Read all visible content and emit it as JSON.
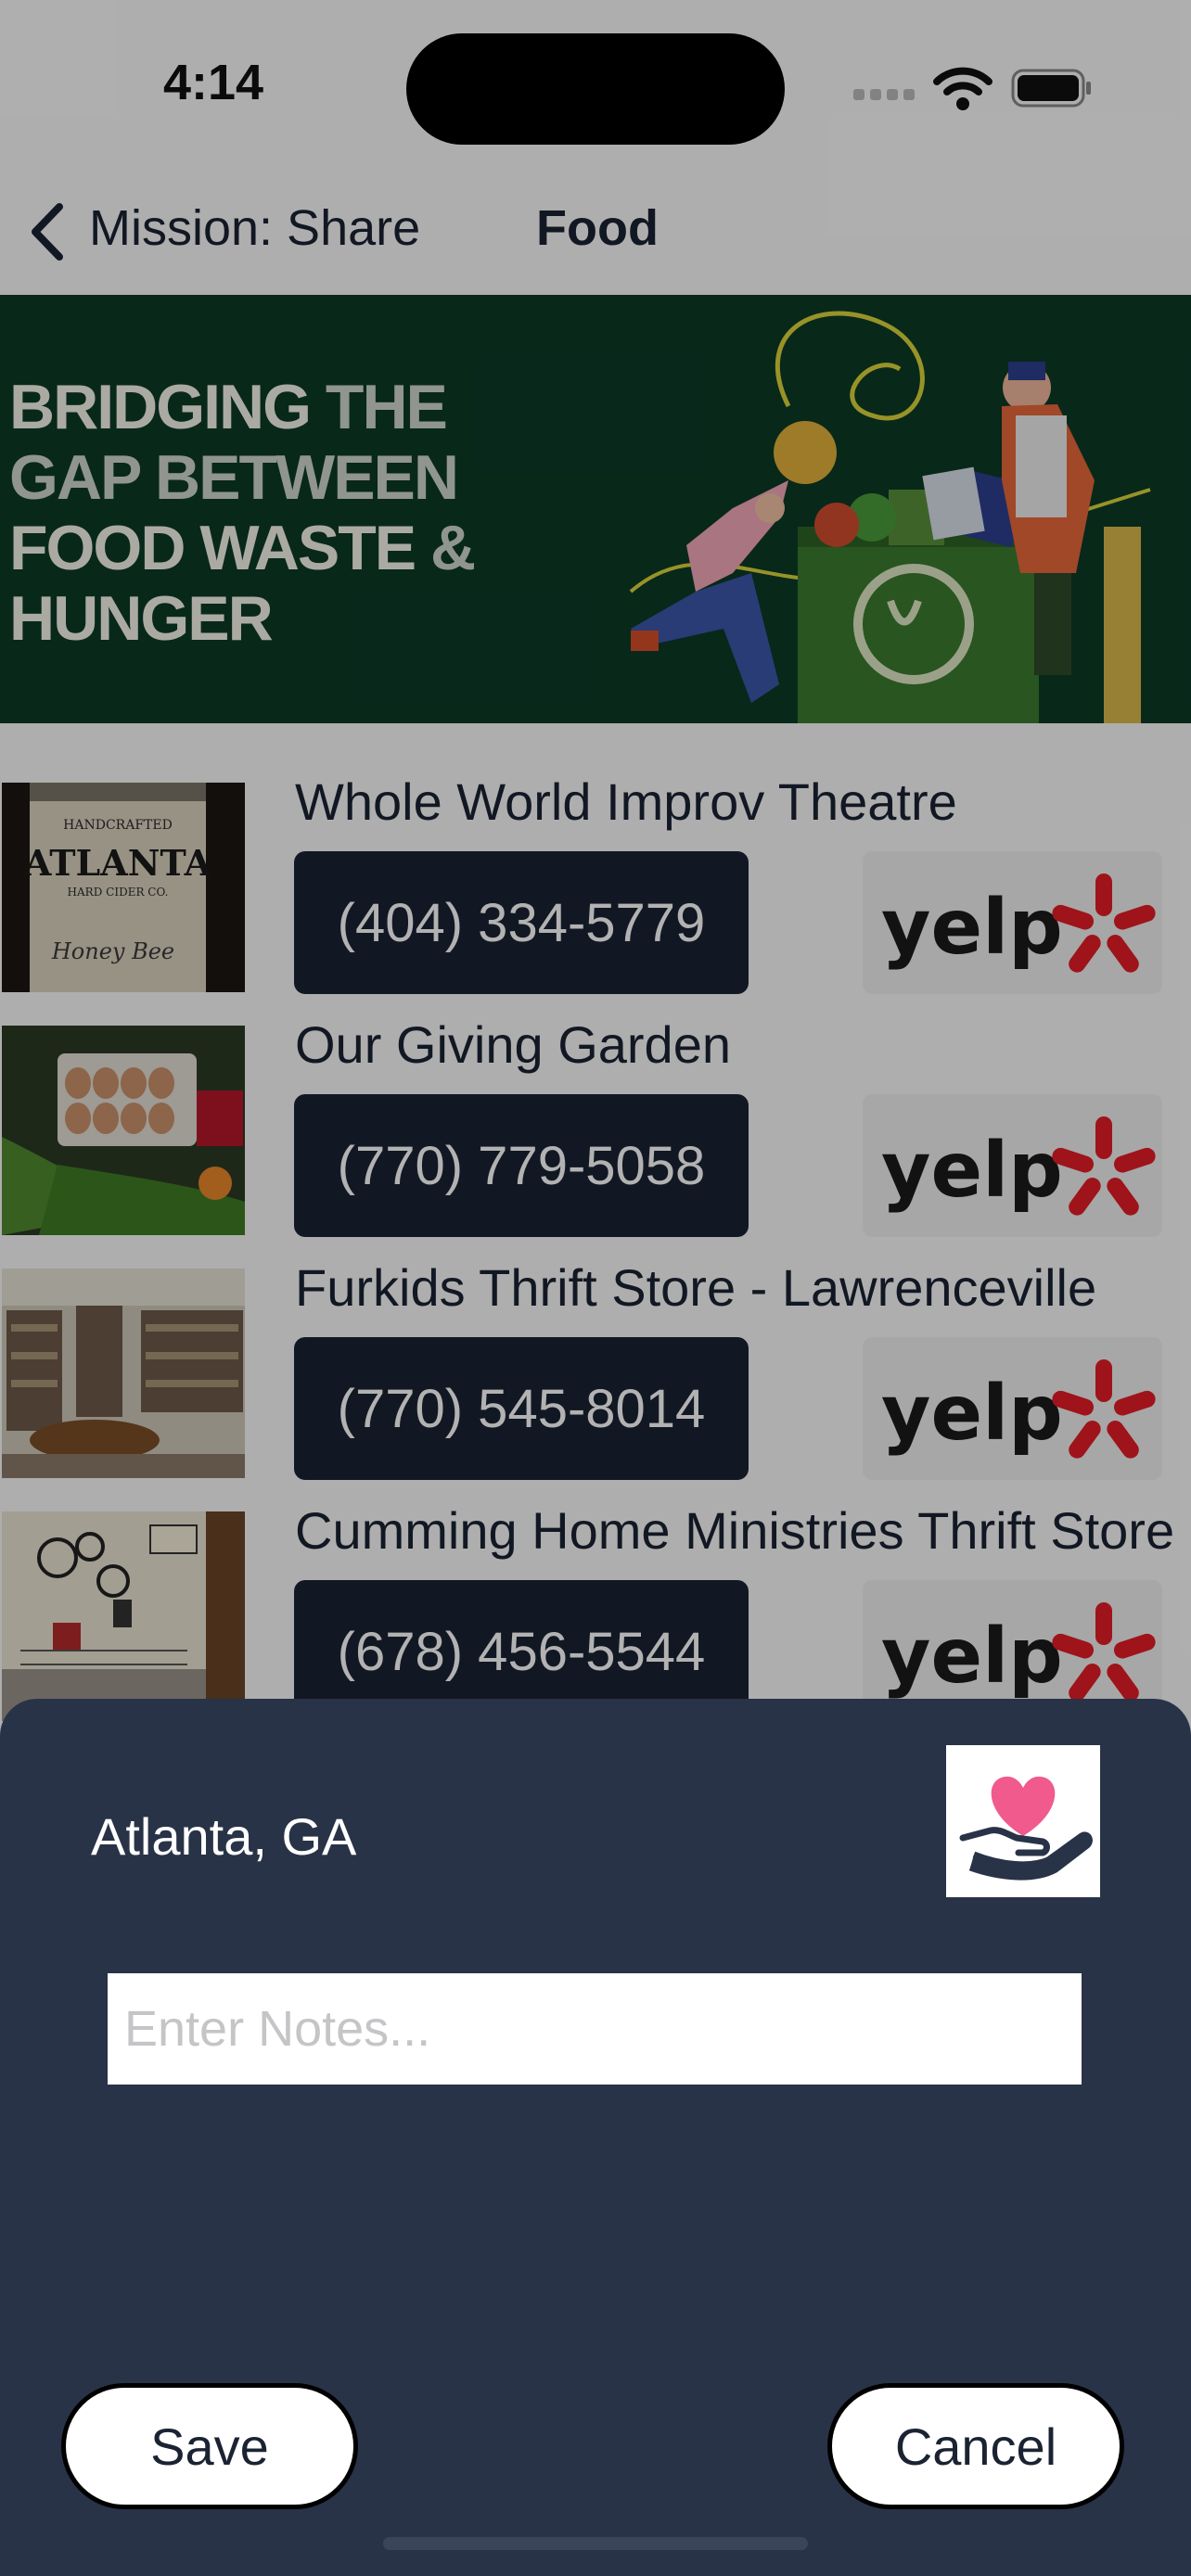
{
  "status_bar": {
    "time": "4:14"
  },
  "nav": {
    "back_label": "Mission: Share",
    "title": "Food"
  },
  "banner": {
    "line1_a": "BRIDGING ",
    "line1_b": "THE",
    "line2": "GAP BETWEEN",
    "line3_a": "FOOD WASTE ",
    "line3_b": "&",
    "line4": "HUNGER"
  },
  "listings": [
    {
      "name": "Whole World Improv Theatre",
      "phone": "(404) 334-5779",
      "yelp": "yelp"
    },
    {
      "name": "Our Giving Garden",
      "phone": "(770) 779-5058",
      "yelp": "yelp"
    },
    {
      "name": "Furkids Thrift Store - Lawrenceville",
      "phone": "(770) 545-8014",
      "yelp": "yelp"
    },
    {
      "name": "Cumming Home Ministries Thrift Store",
      "phone": "(678) 456-5544",
      "yelp": "yelp"
    }
  ],
  "thumb_text": {
    "brand": "ATLANTA",
    "top": "HANDCRAFTED",
    "sub": "HARD CIDER CO.",
    "script": "Honey Bee"
  },
  "sheet": {
    "location": "Atlanta, GA",
    "notes_placeholder": "Enter Notes...",
    "notes_value": "",
    "save_label": "Save",
    "cancel_label": "Cancel"
  },
  "colors": {
    "navy": "#1b2333",
    "sheet_bg": "#283347",
    "banner_bg": "#0c3a26",
    "yelp_red": "#e31e26",
    "heart_pink": "#f05a8c"
  }
}
